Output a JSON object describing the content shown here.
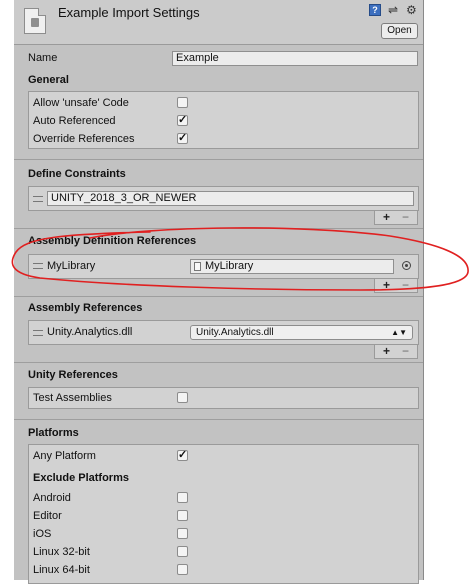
{
  "header": {
    "title": "Example Import Settings",
    "open_label": "Open",
    "icons": [
      "help-icon",
      "settings-sliders-icon",
      "gear-icon",
      "asset-file-icon"
    ]
  },
  "name_row": {
    "label": "Name",
    "value": "Example"
  },
  "general": {
    "heading": "General",
    "items": [
      {
        "label": "Allow 'unsafe' Code",
        "checked": false
      },
      {
        "label": "Auto Referenced",
        "checked": true
      },
      {
        "label": "Override References",
        "checked": true
      }
    ]
  },
  "define_constraints": {
    "heading": "Define Constraints",
    "items": [
      "UNITY_2018_3_OR_NEWER"
    ],
    "add_label": "+",
    "remove_label": "−"
  },
  "assembly_definition_references": {
    "heading": "Assembly Definition References",
    "item_label": "MyLibrary",
    "object_value": "MyLibrary",
    "add_label": "+",
    "remove_label": "−"
  },
  "assembly_references": {
    "heading": "Assembly References",
    "item_label": "Unity.Analytics.dll",
    "dropdown_value": "Unity.Analytics.dll",
    "add_label": "+",
    "remove_label": "−"
  },
  "unity_references": {
    "heading": "Unity References",
    "items": [
      {
        "label": "Test Assemblies",
        "checked": false
      }
    ]
  },
  "platforms": {
    "heading": "Platforms",
    "any_platform": {
      "label": "Any Platform",
      "checked": true
    },
    "exclude_heading": "Exclude Platforms",
    "exclude": [
      {
        "label": "Android",
        "checked": false
      },
      {
        "label": "Editor",
        "checked": false
      },
      {
        "label": "iOS",
        "checked": false
      },
      {
        "label": "Linux 32-bit",
        "checked": false
      },
      {
        "label": "Linux 64-bit",
        "checked": false
      }
    ]
  },
  "colors": {
    "panel": "#c2c2c2",
    "annotation": "#e02020",
    "help_icon": "#3c6fbf"
  }
}
